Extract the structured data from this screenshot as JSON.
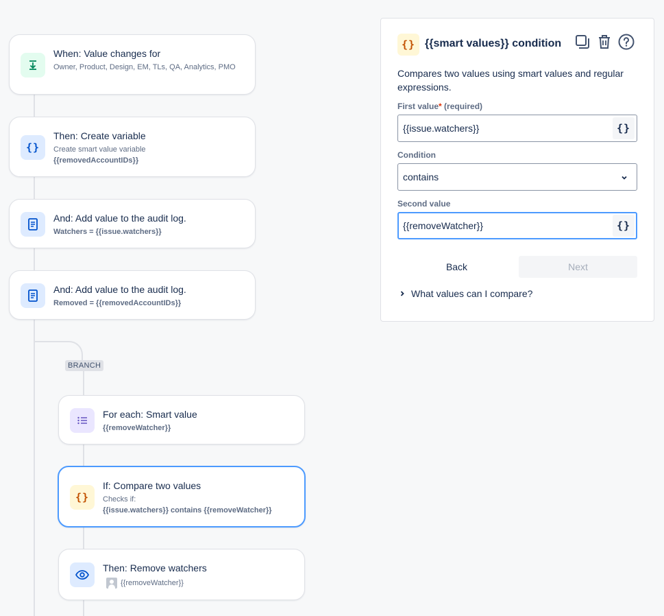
{
  "flow": {
    "trigger": {
      "title": "When: Value changes for",
      "subtitle": "Owner, Product, Design, EM, TLs, QA, Analytics, PMO"
    },
    "create_variable": {
      "title": "Then: Create variable",
      "subtitle": "Create smart value variable",
      "variable": "{{removedAccountIDs}}"
    },
    "audit_log_1": {
      "title": "And: Add value to the audit log.",
      "value": "Watchers = {{issue.watchers}}"
    },
    "audit_log_2": {
      "title": "And: Add value to the audit log.",
      "value": "Removed = {{removedAccountIDs}}"
    },
    "branch_label": "BRANCH",
    "for_each": {
      "title": "For each: Smart value",
      "value": "{{removeWatcher}}"
    },
    "if_compare": {
      "title": "If: Compare two values",
      "subtitle": "Checks if:",
      "value": "{{issue.watchers}} contains {{removeWatcher}}"
    },
    "remove_watchers": {
      "title": "Then: Remove watchers",
      "value": "{{removeWatcher}}"
    }
  },
  "panel": {
    "title": "{{smart values}} condition",
    "icon": "braces-icon",
    "description": "Compares two values using smart values and regular expressions.",
    "first_value": {
      "label": "First value",
      "required_star": "*",
      "required_text": "(required)",
      "value": "{{issue.watchers}}"
    },
    "condition": {
      "label": "Condition",
      "value": "contains"
    },
    "second_value": {
      "label": "Second value",
      "value": "{{removeWatcher}}"
    },
    "back_label": "Back",
    "next_label": "Next",
    "help_expander": "What values can I compare?",
    "smart_value_button": "{}"
  },
  "colors": {
    "accent": "#4c9aff",
    "required": "#de350b",
    "braces_icon": "#c25100"
  }
}
